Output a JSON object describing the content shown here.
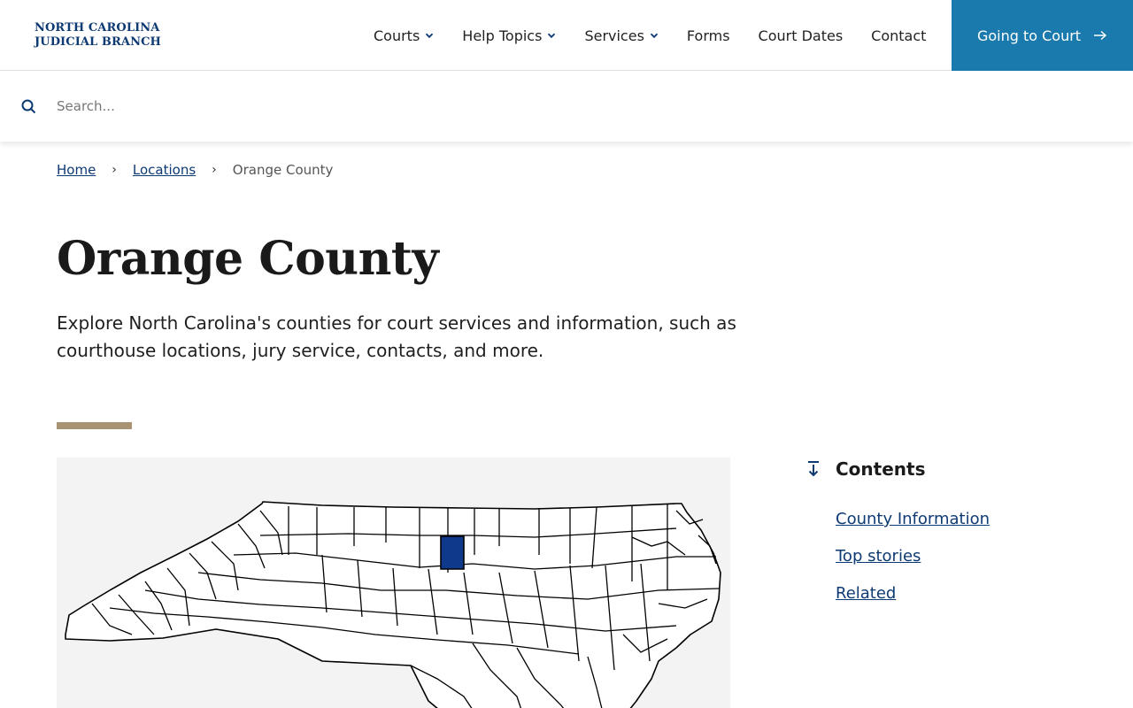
{
  "logo": {
    "line1": "NORTH CAROLINA",
    "line2": "JUDICIAL BRANCH"
  },
  "nav": {
    "items": [
      {
        "label": "Courts",
        "has_dropdown": true
      },
      {
        "label": "Help Topics",
        "has_dropdown": true
      },
      {
        "label": "Services",
        "has_dropdown": true
      },
      {
        "label": "Forms",
        "has_dropdown": false
      },
      {
        "label": "Court Dates",
        "has_dropdown": false
      },
      {
        "label": "Contact",
        "has_dropdown": false
      }
    ],
    "cta_label": "Going to Court"
  },
  "search": {
    "placeholder": "Search...",
    "value": ""
  },
  "breadcrumb": {
    "home": "Home",
    "locations": "Locations",
    "current": "Orange County"
  },
  "page": {
    "title": "Orange County",
    "intro": "Explore North Carolina's counties for court services and information, such as courthouse locations, jury service, contacts, and more."
  },
  "contents": {
    "heading": "Contents",
    "links": [
      "County Information",
      "Top stories",
      "Related"
    ]
  },
  "colors": {
    "brand_navy": "#0e3a73",
    "cta_blue": "#1a7aad",
    "accent_tan": "#a89373",
    "highlight_county": "#0f3a8c"
  },
  "icons": {
    "search": "search-icon",
    "chevron": "chevron-down-icon",
    "arrow": "arrow-right-icon",
    "toc": "arrow-down-to-line-icon"
  }
}
